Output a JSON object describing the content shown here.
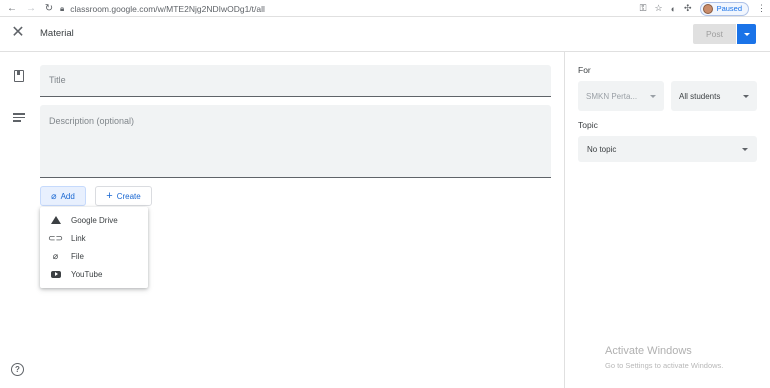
{
  "browser": {
    "url": "classroom.google.com/w/MTE2Njg2NDIwODg1/t/all",
    "profile_status": "Paused"
  },
  "header": {
    "title": "Material",
    "post_label": "Post"
  },
  "form": {
    "title_placeholder": "Title",
    "description_placeholder": "Description (optional)",
    "add_label": "Add",
    "create_label": "Create"
  },
  "add_menu": {
    "items": [
      {
        "label": "Google Drive",
        "icon": "google-drive-icon"
      },
      {
        "label": "Link",
        "icon": "link-icon"
      },
      {
        "label": "File",
        "icon": "paperclip-icon"
      },
      {
        "label": "YouTube",
        "icon": "youtube-icon"
      }
    ]
  },
  "side": {
    "for_label": "For",
    "class_value": "SMKN Perta...",
    "students_value": "All students",
    "topic_label": "Topic",
    "topic_value": "No topic"
  },
  "watermark": {
    "title": "Activate Windows",
    "subtitle": "Go to Settings to activate Windows."
  },
  "colors": {
    "accent": "#1a73e8",
    "field_bg": "#f1f3f4",
    "disabled_bg": "#e0e0e0"
  }
}
